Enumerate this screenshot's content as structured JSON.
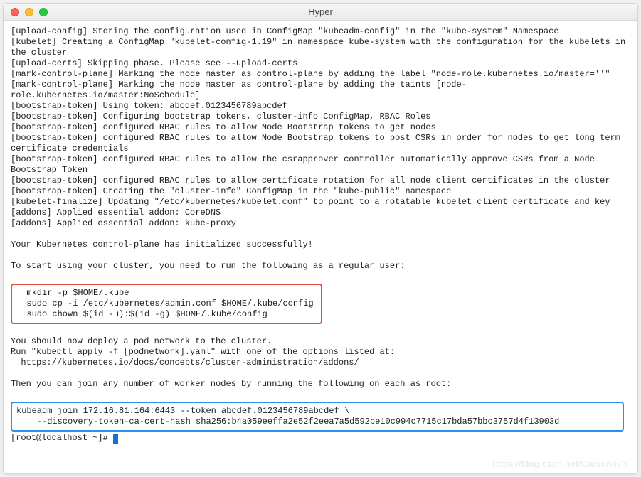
{
  "window": {
    "title": "Hyper"
  },
  "lines": {
    "l1": "[upload-config] Storing the configuration used in ConfigMap \"kubeadm-config\" in the \"kube-system\" Namespace",
    "l2": "[kubelet] Creating a ConfigMap \"kubelet-config-1.19\" in namespace kube-system with the configuration for the kubelets in the cluster",
    "l3": "[upload-certs] Skipping phase. Please see --upload-certs",
    "l4": "[mark-control-plane] Marking the node master as control-plane by adding the label \"node-role.kubernetes.io/master=''\"",
    "l5": "[mark-control-plane] Marking the node master as control-plane by adding the taints [node-role.kubernetes.io/master:NoSchedule]",
    "l6": "[bootstrap-token] Using token: abcdef.0123456789abcdef",
    "l7": "[bootstrap-token] Configuring bootstrap tokens, cluster-info ConfigMap, RBAC Roles",
    "l8": "[bootstrap-token] configured RBAC rules to allow Node Bootstrap tokens to get nodes",
    "l9": "[bootstrap-token] configured RBAC rules to allow Node Bootstrap tokens to post CSRs in order for nodes to get long term certificate credentials",
    "l10": "[bootstrap-token] configured RBAC rules to allow the csrapprover controller automatically approve CSRs from a Node Bootstrap Token",
    "l11": "[bootstrap-token] configured RBAC rules to allow certificate rotation for all node client certificates in the cluster",
    "l12": "[bootstrap-token] Creating the \"cluster-info\" ConfigMap in the \"kube-public\" namespace",
    "l13": "[kubelet-finalize] Updating \"/etc/kubernetes/kubelet.conf\" to point to a rotatable kubelet client certificate and key",
    "l14": "[addons] Applied essential addon: CoreDNS",
    "l15": "[addons] Applied essential addon: kube-proxy",
    "blank1": "",
    "l16": "Your Kubernetes control-plane has initialized successfully!",
    "blank2": "",
    "l17": "To start using your cluster, you need to run the following as a regular user:",
    "blank3": "",
    "red": "  mkdir -p $HOME/.kube\n  sudo cp -i /etc/kubernetes/admin.conf $HOME/.kube/config\n  sudo chown $(id -u):$(id -g) $HOME/.kube/config",
    "blank4": "",
    "l18": "You should now deploy a pod network to the cluster.",
    "l19": "Run \"kubectl apply -f [podnetwork].yaml\" with one of the options listed at:",
    "l20": "  https://kubernetes.io/docs/concepts/cluster-administration/addons/",
    "blank5": "",
    "l21": "Then you can join any number of worker nodes by running the following on each as root:",
    "blank6": "",
    "blue": "kubeadm join 172.16.81.164:6443 --token abcdef.0123456789abcdef \\\n    --discovery-token-ca-cert-hash sha256:b4a059eeffa2e52f2eea7a5d592be10c994c7715c17bda57bbc3757d4f13903d",
    "prompt": "[root@localhost ~]# "
  },
  "watermark": "https://blog.csdn.net/Carson073"
}
